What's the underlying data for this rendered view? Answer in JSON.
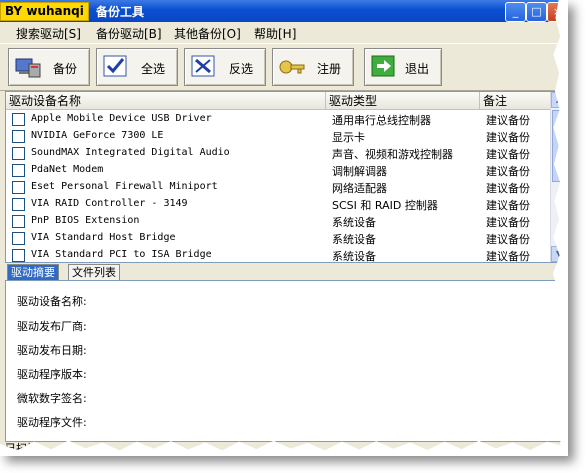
{
  "titlebar": {
    "brand": "BY wuhanqi",
    "title": "备份工具",
    "buttons": [
      "_",
      "□",
      "×"
    ]
  },
  "menu": [
    "搜索驱动[S]",
    "备份驱动[B]",
    "其他备份[O]",
    "帮助[H]"
  ],
  "toolbar": {
    "backup": "备份",
    "select_all": "全选",
    "invert": "反选",
    "register": "注册",
    "exit": "退出"
  },
  "columns": [
    "驱动设备名称",
    "驱动类型",
    "备注"
  ],
  "drivers": [
    {
      "name": "Apple Mobile Device USB Driver",
      "type": "通用串行总线控制器",
      "note": "建议备份"
    },
    {
      "name": "NVIDIA GeForce 7300 LE",
      "type": "显示卡",
      "note": "建议备份"
    },
    {
      "name": "SoundMAX Integrated Digital Audio",
      "type": "声音、视频和游戏控制器",
      "note": "建议备份"
    },
    {
      "name": "PdaNet Modem",
      "type": "调制解调器",
      "note": "建议备份"
    },
    {
      "name": "Eset Personal Firewall Miniport",
      "type": "网络适配器",
      "note": "建议备份"
    },
    {
      "name": "VIA RAID Controller - 3149",
      "type": "SCSI 和 RAID 控制器",
      "note": "建议备份"
    },
    {
      "name": "PnP BIOS Extension",
      "type": "系统设备",
      "note": "建议备份"
    },
    {
      "name": "VIA Standard Host Bridge",
      "type": "系统设备",
      "note": "建议备份"
    },
    {
      "name": "VIA Standard PCI to ISA Bridge",
      "type": "系统设备",
      "note": "建议备份"
    }
  ],
  "tabs": [
    "驱动摘要",
    "文件列表"
  ],
  "details": [
    "驱动设备名称:",
    "驱动发布厂商:",
    "驱动发布日期:",
    "驱动程序版本:",
    "微软数字签名:",
    "驱动程序文件:"
  ],
  "status": "已扫描"
}
